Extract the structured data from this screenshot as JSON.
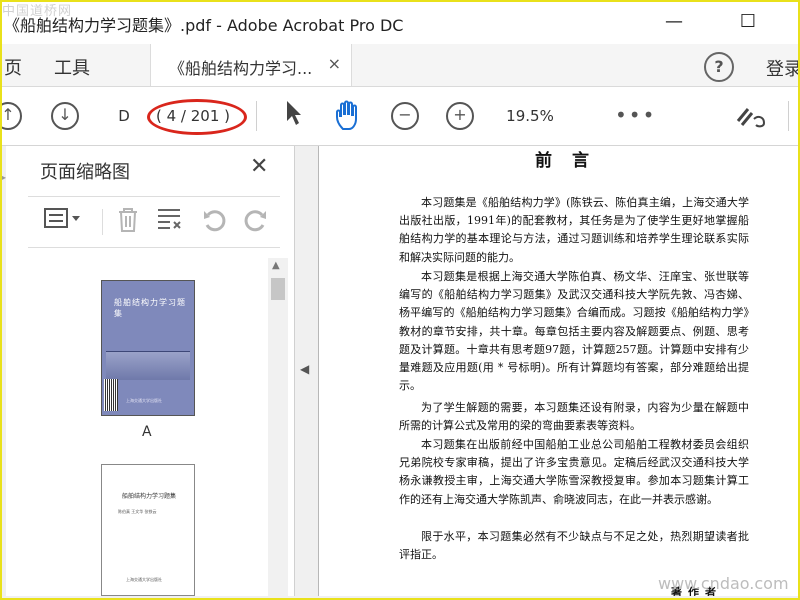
{
  "window": {
    "title": "《船舶结构力学习题集》.pdf - Adobe Acrobat Pro DC",
    "watermark_top": "中国道桥网",
    "minimize": "—",
    "maximize": "☐"
  },
  "menubar": {
    "items": [
      "页",
      "工具"
    ],
    "tab_label": "《船舶结构力学习...",
    "tab_close": "×",
    "help": "?",
    "login": "登录"
  },
  "toolbar": {
    "page_current": "D",
    "page_count": "( 4 / 201 )",
    "zoom": "19.5%",
    "more": "•••"
  },
  "panel": {
    "title": "页面缩略图",
    "close": "✕",
    "thumb1_label": "A",
    "thumb1_cover_title": "船舶结构力学习题集",
    "thumb1_cover_sub": "上海交通大学出版社",
    "thumb2_title": "船舶结构力学习题集",
    "thumb2_line": "陈伯真  王文华  张铁云",
    "thumb2_publisher": "上海交通大学出版社"
  },
  "document": {
    "heading": "前言",
    "paragraphs": [
      "本习题集是《船舶结构力学》(陈铁云、陈伯真主编，上海交通大学出版社出版，1991年)的配套教材，其任务是为了使学生更好地掌握船舶结构力学的基本理论与方法，通过习题训练和培养学生理论联系实际和解决实际问题的能力。",
      "本习题集是根据上海交通大学陈伯真、杨文华、汪庠宝、张世联等编写的《船舶结构力学习题集》及武汉交通科技大学阮先敦、冯杏娣、杨平编写的《船舶结构力学习题集》合编而成。习题按《船舶结构力学》教材的章节安排，共十章。每章包括主要内容及解题要点、例题、思考题及计算题。十章共有思考题97题，计算题257题。计算题中安排有少量难题及应用题(用 * 号标明)。所有计算题均有答案，部分难题给出提示。",
      "为了学生解题的需要，本习题集还设有附录，内容为少量在解题中所需的计算公式及常用的梁的弯曲要素表等资料。",
      "本习题集在出版前经中国船舶工业总公司船舶工程教材委员会组织兄弟院校专家审稿，提出了许多宝贵意见。定稿后经武汉交通科技大学杨永谦教授主审，上海交通大学陈雪深教授复审。参加本习题集计算工作的还有上海交通大学陈凯声、俞晓波同志，在此一并表示感谢。",
      "限于水平，本习题集必然有不少缺点与不足之处，热烈期望读者批评指正。"
    ],
    "author": "著作者"
  },
  "watermark_br": "www.cndao.com",
  "colors": {
    "highlight_ellipse": "#d9261c",
    "frame": "#e9e11b",
    "cover_blue": "#7f89bb"
  }
}
